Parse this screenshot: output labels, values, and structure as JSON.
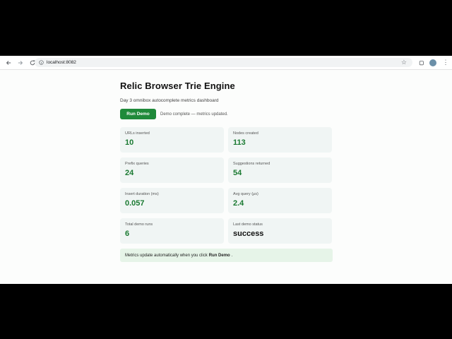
{
  "browser": {
    "url": "localhost:8082"
  },
  "page": {
    "title": "Relic Browser Trie Engine",
    "subtitle": "Day 3 omnibox autocomplete metrics dashboard",
    "run_button": "Run Demo",
    "status": "Demo complete — metrics updated."
  },
  "metrics": [
    {
      "label": "URLs inserted",
      "value": "10"
    },
    {
      "label": "Nodes created",
      "value": "113"
    },
    {
      "label": "Prefix queries",
      "value": "24"
    },
    {
      "label": "Suggestions returned",
      "value": "54"
    },
    {
      "label": "Insert duration (ms)",
      "value": "0.057"
    },
    {
      "label": "Avg query (μs)",
      "value": "2.4"
    },
    {
      "label": "Total demo runs",
      "value": "6"
    },
    {
      "label": "Last demo status",
      "value": "success"
    }
  ],
  "note": {
    "prefix": "Metrics update automatically when you click",
    "bold": "Run Demo",
    "suffix": "."
  },
  "colors": {
    "accent": "#1f8a3a",
    "value_green": "#1b7a32",
    "card_bg": "#f0f5f4",
    "note_bg": "#e6f4e8"
  }
}
